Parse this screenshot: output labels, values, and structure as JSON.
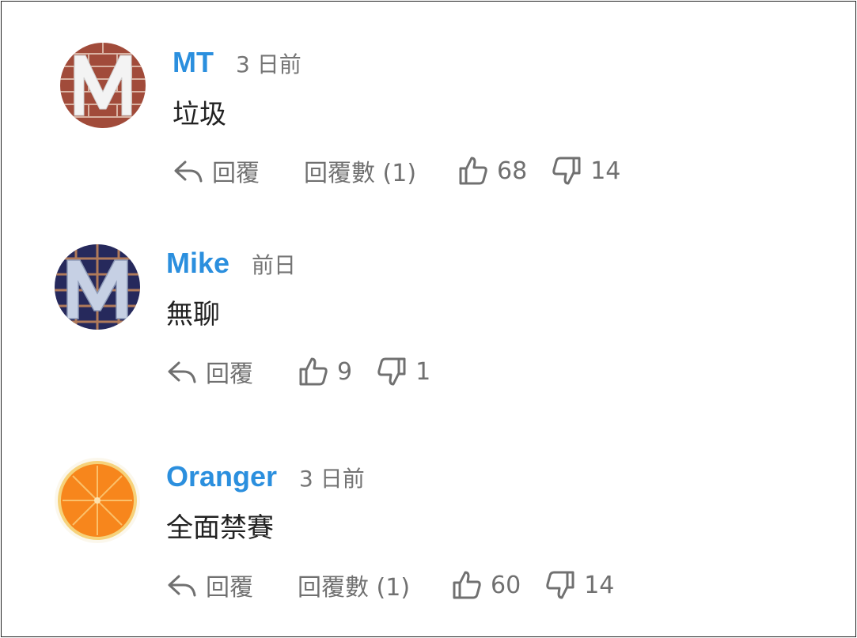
{
  "labels": {
    "reply": "回覆",
    "reply_count_prefix": "回覆數"
  },
  "colors": {
    "author": "#2b8fde",
    "timestamp": "#757575",
    "text": "#222222",
    "action": "#707070"
  },
  "icons": {
    "reply": "reply-arrow-icon",
    "like": "thumbs-up-icon",
    "dislike": "thumbs-down-icon"
  },
  "comments": [
    {
      "author": "MT",
      "time": "3 日前",
      "text": "垃圾",
      "reply_count": "回覆數 (1)",
      "likes": "68",
      "dislikes": "14",
      "avatar": "brick-wall-M-avatar"
    },
    {
      "author": "Mike",
      "time": "前日",
      "text": "無聊",
      "likes": "9",
      "dislikes": "1",
      "avatar": "blue-grid-M-avatar"
    },
    {
      "author": "Oranger",
      "time": "3 日前",
      "text": "全面禁賽",
      "reply_count": "回覆數 (1)",
      "likes": "60",
      "dislikes": "14",
      "avatar": "orange-slice-avatar"
    }
  ]
}
